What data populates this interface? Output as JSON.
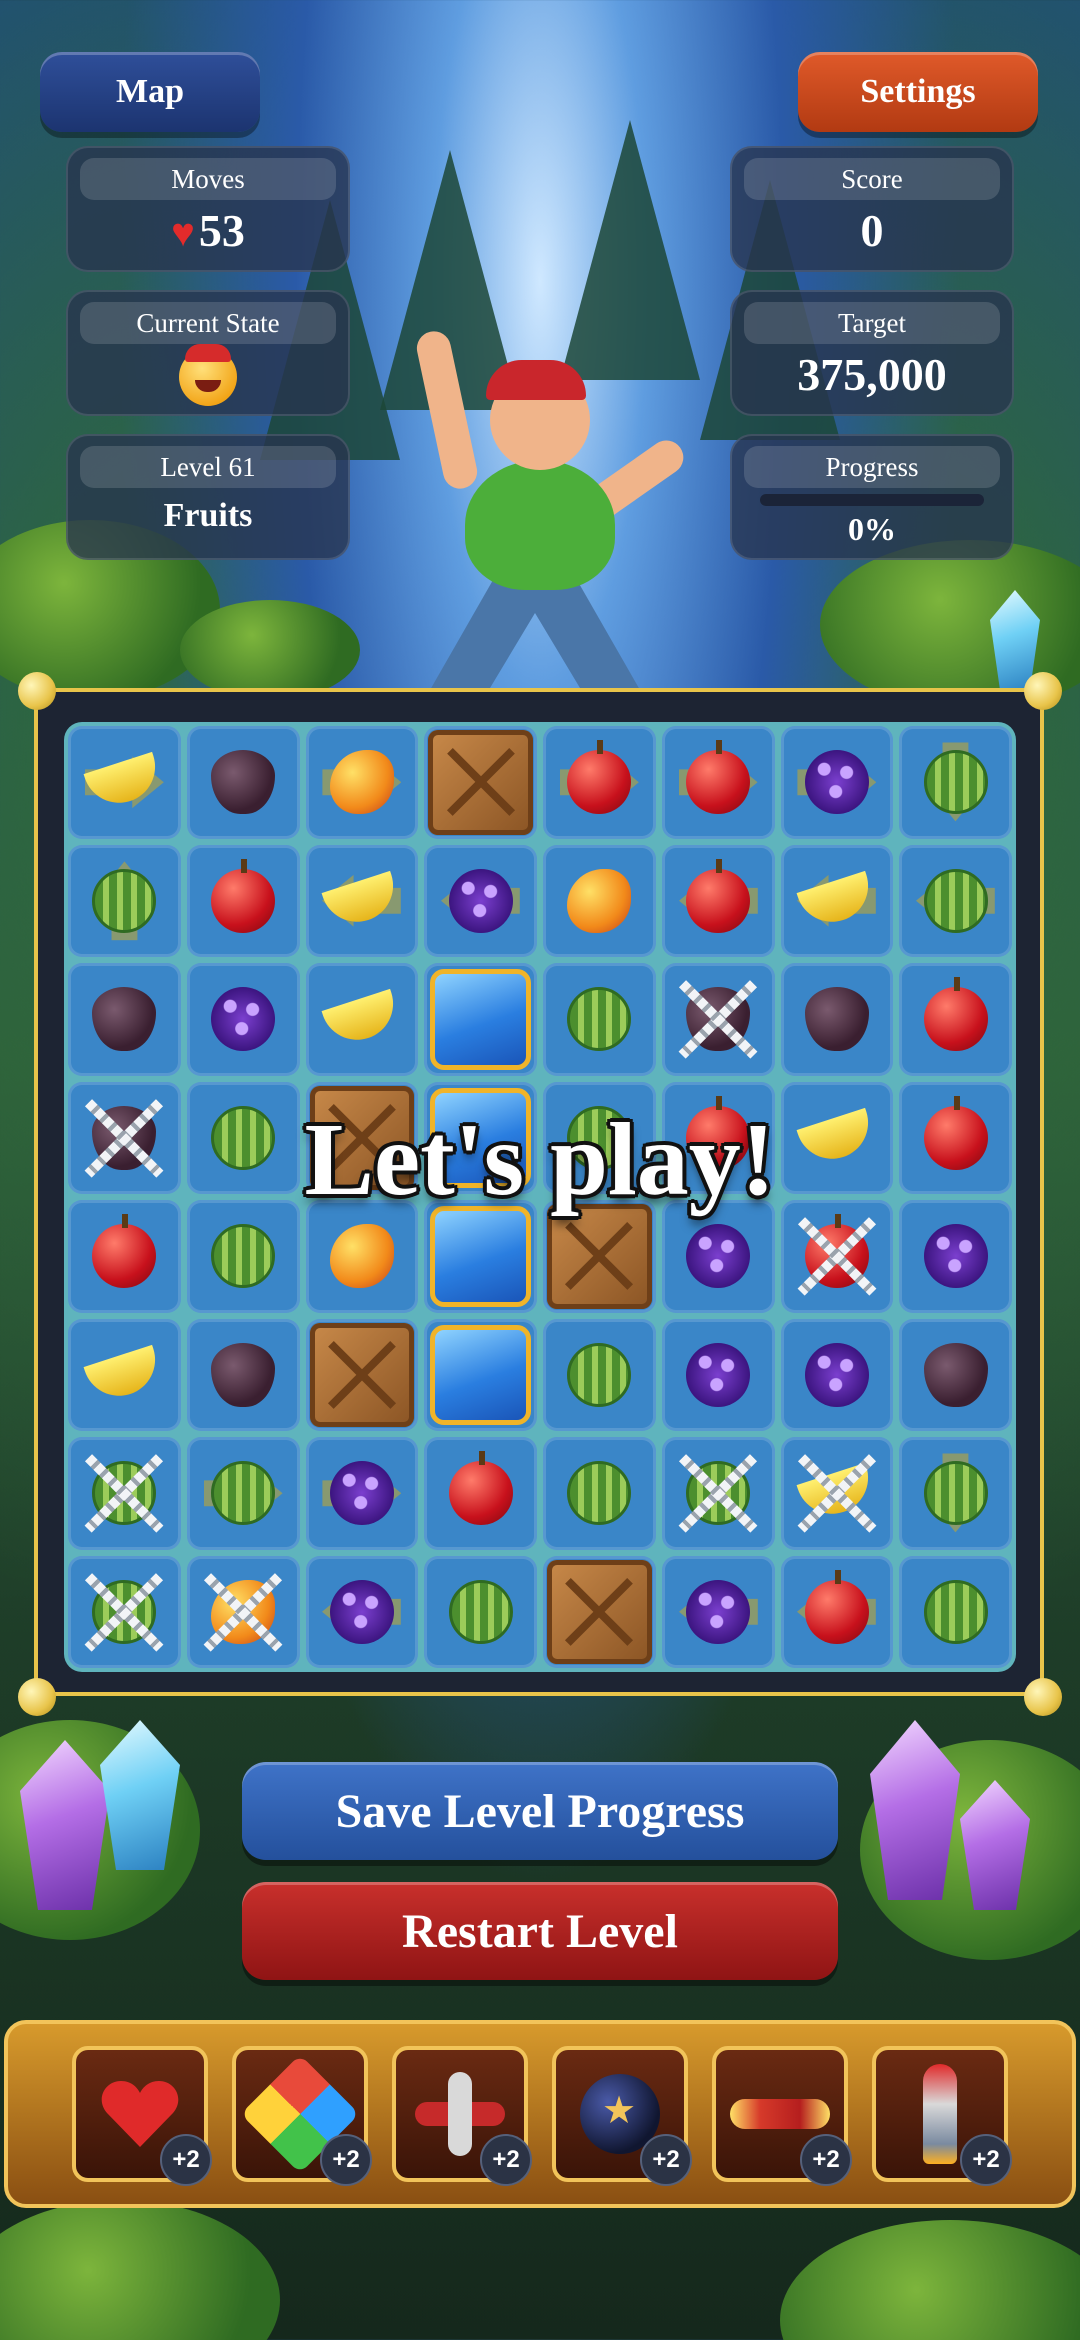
{
  "top_bar": {
    "map_label": "Map",
    "settings_label": "Settings"
  },
  "stats": {
    "moves": {
      "caption": "Moves",
      "value": "53"
    },
    "score": {
      "caption": "Score",
      "value": "0"
    },
    "state": {
      "caption": "Current State"
    },
    "target": {
      "caption": "Target",
      "value": "375,000"
    },
    "level": {
      "caption": "Level 61",
      "name": "Fruits"
    },
    "progress": {
      "caption": "Progress",
      "value": "0%",
      "fraction": 0
    }
  },
  "overlay_text": "Let's play!",
  "board": {
    "rows": [
      [
        "banana:right",
        "fig",
        "mango:right",
        "crate",
        "apple:right",
        "apple:right",
        "grape:right",
        "melon:down"
      ],
      [
        "melon:up",
        "apple",
        "banana:left",
        "grape:left",
        "mango",
        "apple:left",
        "banana:left",
        "melon:left"
      ],
      [
        "fig",
        "grape",
        "banana",
        "ice",
        "melon",
        "fig:chain",
        "fig",
        "apple"
      ],
      [
        "fig:chain",
        "melon",
        "crate",
        "ice",
        "melon",
        "apple",
        "banana",
        "apple"
      ],
      [
        "apple",
        "melon",
        "mango",
        "ice",
        "crate",
        "grape",
        "apple:chain",
        "grape"
      ],
      [
        "banana",
        "fig",
        "crate",
        "ice",
        "melon",
        "grape",
        "grape",
        "fig"
      ],
      [
        "melon:chain",
        "melon:right",
        "grape:right",
        "apple",
        "melon",
        "melon:chain",
        "banana:chain",
        "melon:down"
      ],
      [
        "melon:chain",
        "mango:chain",
        "grape:left",
        "melon",
        "crate",
        "grape:left",
        "apple:left",
        "melon"
      ]
    ]
  },
  "actions": {
    "save_label": "Save Level Progress",
    "restart_label": "Restart Level"
  },
  "boosters": [
    {
      "icon": "heart-icon",
      "count": "+2"
    },
    {
      "icon": "color-cube-icon",
      "count": "+2"
    },
    {
      "icon": "plane-icon",
      "count": "+2"
    },
    {
      "icon": "bomb-icon",
      "count": "+2"
    },
    {
      "icon": "horizontal-rocket-icon",
      "count": "+2"
    },
    {
      "icon": "vertical-rocket-icon",
      "count": "+2"
    }
  ],
  "colors": {
    "map_button": "#2f4f9a",
    "settings_button": "#e05a2a",
    "save_button": "#3f73c8",
    "restart_button": "#c9302c",
    "board_border": "#e8c44a"
  }
}
